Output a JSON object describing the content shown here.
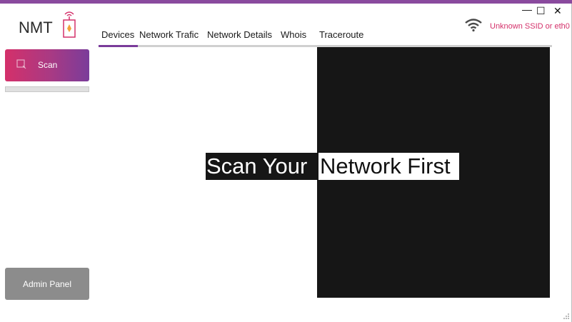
{
  "app": {
    "logo_text": "NMT",
    "brand_colors": {
      "accent": "#7a3c9a",
      "scan_gradient_start": "#d4306a",
      "ssid": "#d4306a"
    }
  },
  "window_controls": {
    "minimize": "—",
    "maximize": "☐",
    "close": "✕"
  },
  "sidebar": {
    "scan_button": {
      "label": "Scan",
      "icon": "search-icon"
    },
    "progress": {
      "value": 0
    },
    "admin_button": {
      "label": "Admin Panel"
    }
  },
  "tabs": [
    {
      "label": "Devices",
      "active": true
    },
    {
      "label": "Network Trafic",
      "active": false
    },
    {
      "label": "Network Details",
      "active": false
    },
    {
      "label": "Whois",
      "active": false
    },
    {
      "label": "Traceroute",
      "active": false
    }
  ],
  "network_status": {
    "icon": "wifi-icon",
    "ssid_text": "Unknown SSID or eth0"
  },
  "main": {
    "message_part1": "Scan Your",
    "message_part2": "Network First"
  }
}
